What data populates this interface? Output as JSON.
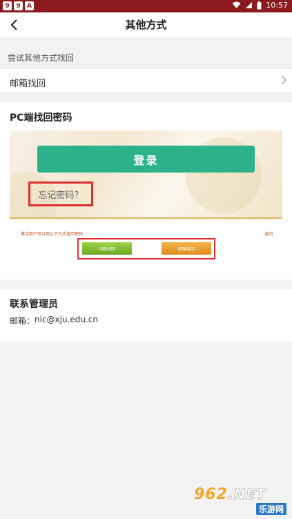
{
  "status_bar": {
    "badges": [
      "9",
      "9",
      "A"
    ],
    "time": "10:57"
  },
  "navbar": {
    "title": "其他方式"
  },
  "hint": "尝试其他方式找回",
  "email_recovery": {
    "label": "邮箱找回"
  },
  "pc_section": {
    "heading": "PC端找回密码",
    "login_button": "登录",
    "forgot_link": "忘记密码？",
    "sub_text": "激活用户可以用以下方式找回密码",
    "sub_back": "返回",
    "sub_button_1": "问题找回",
    "sub_button_2": "邮箱找回"
  },
  "admin": {
    "heading": "联系管理员",
    "email_label": "邮箱：",
    "email_value": "nic@xju.edu.cn"
  },
  "watermark": {
    "top": "962",
    "top_suffix": ".NET",
    "bottom": "乐游网"
  },
  "colors": {
    "status_bar": "#8b1a1e",
    "login_button": "#2bb28a",
    "highlight": "#e02d2d"
  }
}
